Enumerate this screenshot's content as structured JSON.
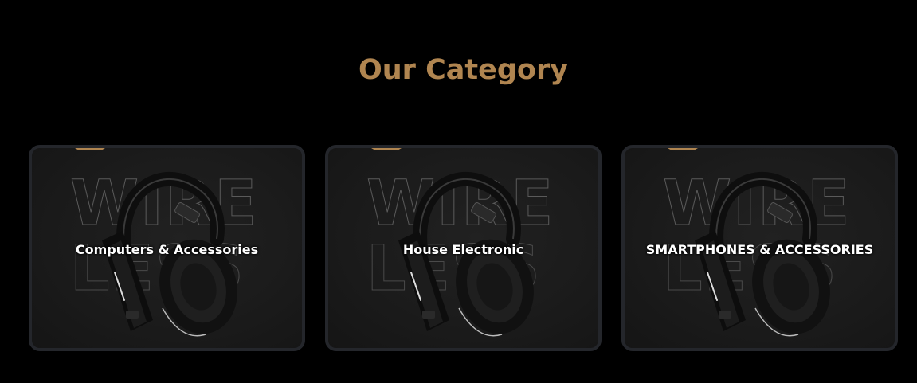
{
  "section": {
    "title": "Our Category",
    "title_color": "#b08550",
    "accent_color": "#b08550"
  },
  "categories": [
    {
      "label": "Computers & Accessories",
      "background_word_top": "WIRE",
      "background_word_bottom": "LESS",
      "image_icon": "headphones-icon"
    },
    {
      "label": "House Electronic",
      "background_word_top": "WIRE",
      "background_word_bottom": "LESS",
      "image_icon": "headphones-icon"
    },
    {
      "label": "SMARTPHONES & ACCESSORIES",
      "background_word_top": "WIRE",
      "background_word_bottom": "LESS",
      "image_icon": "headphones-icon"
    }
  ]
}
